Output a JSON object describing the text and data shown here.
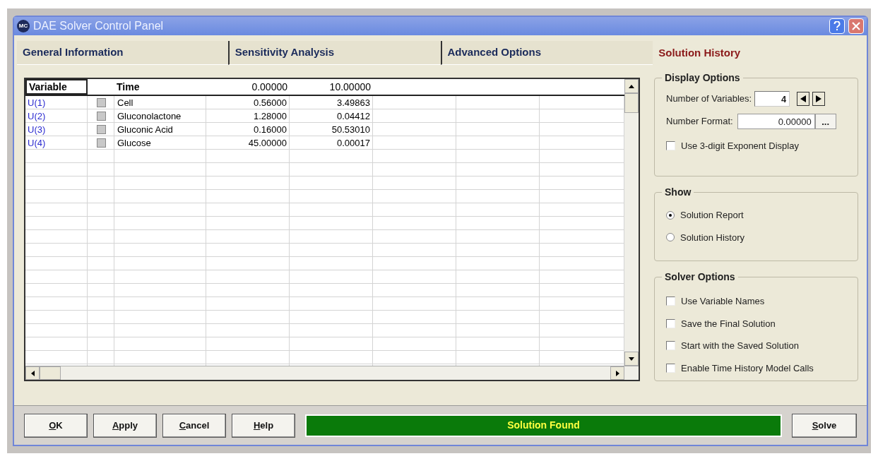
{
  "window": {
    "title": "DAE Solver Control Panel",
    "logo": "MC"
  },
  "tabs": [
    {
      "label": "General Information",
      "selected": false
    },
    {
      "label": "Sensitivity Analysis",
      "selected": false
    },
    {
      "label": "Advanced Options",
      "selected": false
    },
    {
      "label": "Solution History",
      "selected": true
    }
  ],
  "table": {
    "columns": [
      "Variable",
      "",
      "Time",
      "0.00000",
      "10.00000"
    ],
    "rows": [
      {
        "variable": "U(1)",
        "name": "Cell",
        "values": [
          "0.56000",
          "3.49863"
        ]
      },
      {
        "variable": "U(2)",
        "name": "Gluconolactone",
        "values": [
          "1.28000",
          "0.04412"
        ]
      },
      {
        "variable": "U(3)",
        "name": "Gluconic Acid",
        "values": [
          "0.16000",
          "50.53010"
        ]
      },
      {
        "variable": "U(4)",
        "name": "Glucose",
        "values": [
          "45.00000",
          "0.00017"
        ]
      }
    ]
  },
  "display_options": {
    "title": "Display Options",
    "number_of_variables": {
      "label": "Number of Variables:",
      "value": "4"
    },
    "number_format": {
      "label": "Number Format:",
      "value": "0.00000",
      "button": "..."
    },
    "exponent": {
      "label": "Use 3-digit Exponent Display",
      "checked": false
    }
  },
  "show": {
    "title": "Show",
    "options": [
      {
        "label": "Solution Report",
        "selected": true
      },
      {
        "label": "Solution History",
        "selected": false
      }
    ]
  },
  "solver_options": {
    "title": "Solver Options",
    "options": [
      {
        "label": "Use Variable Names",
        "checked": false
      },
      {
        "label": "Save the Final Solution",
        "checked": false
      },
      {
        "label": "Start with the Saved Solution",
        "checked": false
      },
      {
        "label": "Enable Time History Model Calls",
        "checked": false
      }
    ]
  },
  "buttons": [
    {
      "label": "OK",
      "mnemonic": true
    },
    {
      "label": "Apply",
      "mnemonic": true
    },
    {
      "label": "Cancel",
      "mnemonic": true
    },
    {
      "label": "Help",
      "mnemonic": true
    }
  ],
  "status": "Solution Found",
  "solve_button": {
    "label": "Solve",
    "mnemonic": true
  }
}
